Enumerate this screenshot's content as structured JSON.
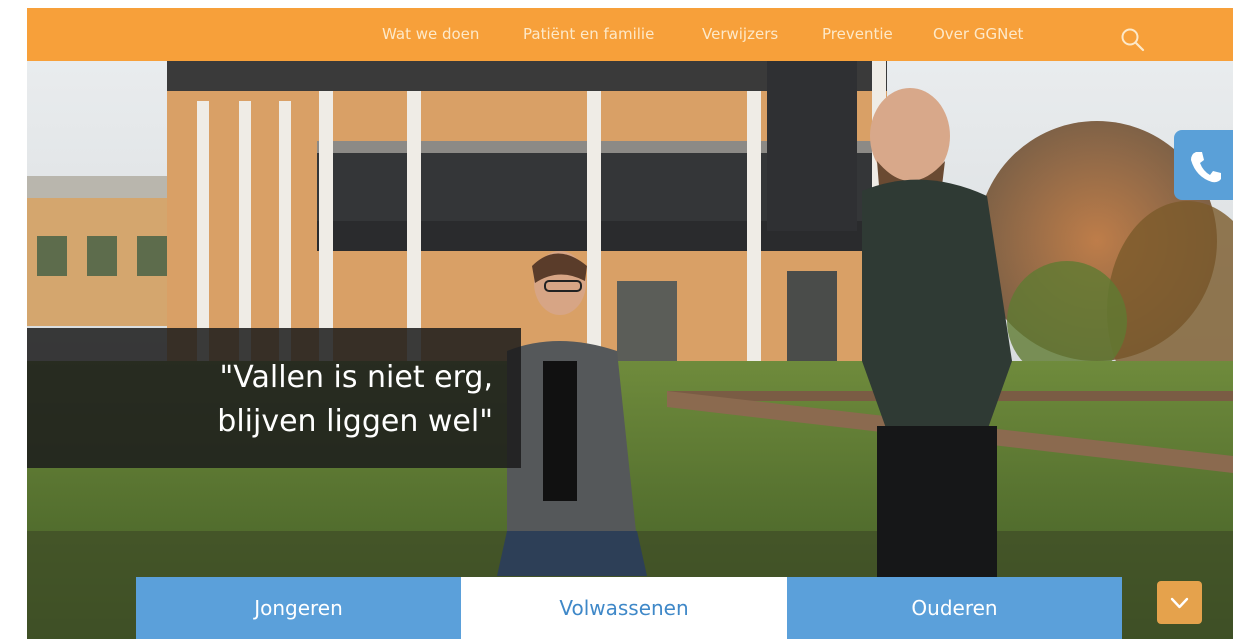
{
  "nav": {
    "items": [
      {
        "label": "Wat we doen"
      },
      {
        "label": "Patiënt en familie"
      },
      {
        "label": "Verwijzers"
      },
      {
        "label": "Preventie"
      },
      {
        "label": "Over GGNet"
      }
    ],
    "search_icon": "search-icon"
  },
  "hero": {
    "quote_line1": "\"Vallen is niet erg,",
    "quote_line2": "blijven liggen wel\""
  },
  "contact": {
    "icon": "phone-icon"
  },
  "tabs": [
    {
      "label": "Jongeren"
    },
    {
      "label": "Volwassenen",
      "active": true
    },
    {
      "label": "Ouderen"
    }
  ],
  "scroll": {
    "icon": "chevron-down-icon"
  },
  "colors": {
    "nav_bg": "#f7a03a",
    "tab_blue": "#5ba0da",
    "tab_active_text": "#3f88c8",
    "phone_bg": "#5aa0d8",
    "scroll_btn": "#e5a24c"
  }
}
